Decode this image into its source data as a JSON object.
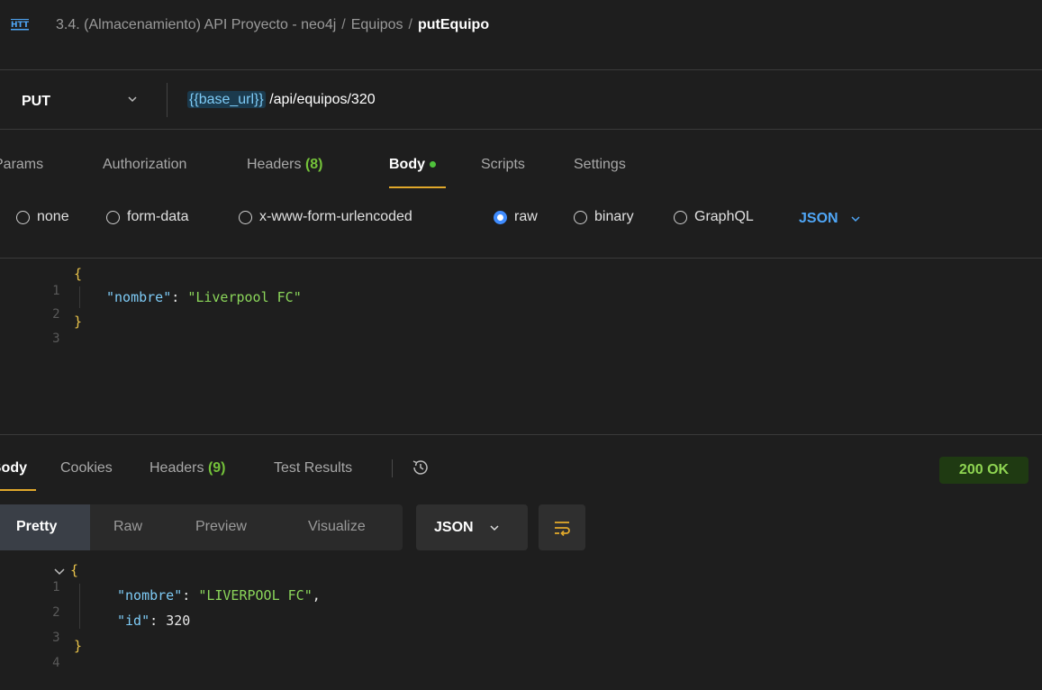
{
  "window": {
    "breadcrumb": {
      "collection": "3.4. (Almacenamiento) API Proyecto - neo4j",
      "folder": "Equipos",
      "request": "putEquipo",
      "separator": "/"
    }
  },
  "request": {
    "method": "PUT",
    "url_variable": "{{base_url}}",
    "url_path": " /api/equipos/320",
    "tabs": [
      {
        "label": "Params"
      },
      {
        "label": "Authorization"
      },
      {
        "label": "Headers",
        "count": "(8)"
      },
      {
        "label": "Body"
      },
      {
        "label": "Scripts"
      },
      {
        "label": "Settings"
      }
    ],
    "body_types": [
      "none",
      "form-data",
      "x-www-form-urlencoded",
      "raw",
      "binary",
      "GraphQL"
    ],
    "selected_body_type": "raw",
    "language": "JSON",
    "body_lines": [
      {
        "n": "1",
        "text": "{"
      },
      {
        "n": "2",
        "key": "\"nombre\"",
        "colon": ": ",
        "value": "\"Liverpool FC\""
      },
      {
        "n": "3",
        "text": "}"
      }
    ]
  },
  "response": {
    "tabs": [
      {
        "label": "Body"
      },
      {
        "label": "Cookies"
      },
      {
        "label": "Headers",
        "count": "(9)"
      },
      {
        "label": "Test Results"
      }
    ],
    "status": "200 OK",
    "view_modes": [
      "Pretty",
      "Raw",
      "Preview",
      "Visualize"
    ],
    "active_view": "Pretty",
    "format": "JSON",
    "body_lines": [
      {
        "n": "1",
        "text": "{"
      },
      {
        "n": "2",
        "key": "\"nombre\"",
        "colon": ": ",
        "value": "\"LIVERPOOL FC\"",
        "trail": ","
      },
      {
        "n": "3",
        "key": "\"id\"",
        "colon": ": ",
        "value": "320"
      },
      {
        "n": "4",
        "text": "}"
      }
    ]
  },
  "colors": {
    "background": "#1e1e1e",
    "accent_underline": "#e0a82b",
    "count_green": "#74c23a",
    "json_key": "#7ecbf6",
    "json_string": "#8bd65a",
    "radio_on": "#3f8cff",
    "status_bg": "#1f3a12",
    "status_text": "#8fd552"
  },
  "icons": {
    "app": "http-icon",
    "method_dropdown": "chevron-down-icon",
    "history": "history-icon",
    "wrap": "wrap-lines-icon",
    "fold": "chevron-down-icon"
  }
}
